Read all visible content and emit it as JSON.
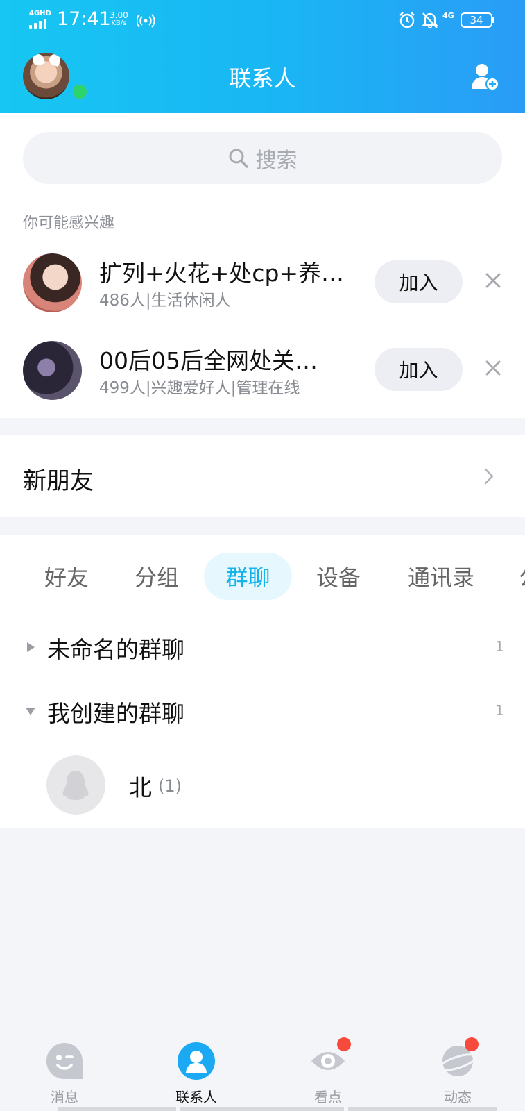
{
  "status_bar": {
    "network": "4GHD",
    "time": "17:41",
    "speed_value": "3.00",
    "speed_unit": "KB/s",
    "network_right": "4G",
    "battery": "34"
  },
  "header": {
    "title": "联系人"
  },
  "search": {
    "placeholder": "搜索"
  },
  "recommend": {
    "section_label": "你可能感兴趣",
    "items": [
      {
        "name": "扩列+火花+处cp+养…",
        "desc": "486人|生活休闲人",
        "button": "加入"
      },
      {
        "name": "00后05后全网处关…",
        "desc": "499人|兴趣爱好人|管理在线",
        "button": "加入"
      }
    ]
  },
  "new_friends": {
    "label": "新朋友"
  },
  "tabs": [
    {
      "label": "好友",
      "active": false
    },
    {
      "label": "分组",
      "active": false
    },
    {
      "label": "群聊",
      "active": true
    },
    {
      "label": "设备",
      "active": false
    },
    {
      "label": "通讯录",
      "active": false
    },
    {
      "label": "公",
      "active": false
    }
  ],
  "groups": [
    {
      "title": "未命名的群聊",
      "count": "1",
      "expanded": false
    },
    {
      "title": "我创建的群聊",
      "count": "1",
      "expanded": true
    }
  ],
  "group_chats": [
    {
      "name": "北",
      "members": "(1)"
    }
  ],
  "bottom_nav": [
    {
      "label": "消息",
      "icon": "message-icon",
      "active": false,
      "badge": false
    },
    {
      "label": "联系人",
      "icon": "contacts-icon",
      "active": true,
      "badge": false
    },
    {
      "label": "看点",
      "icon": "eye-icon",
      "active": false,
      "badge": true
    },
    {
      "label": "动态",
      "icon": "planet-icon",
      "active": false,
      "badge": true
    }
  ],
  "colors": {
    "header_start": "#17c6f2",
    "header_end": "#2a9cf6",
    "accent": "#14b4ea",
    "online": "#2dd46b",
    "badge": "#f64b3c"
  }
}
